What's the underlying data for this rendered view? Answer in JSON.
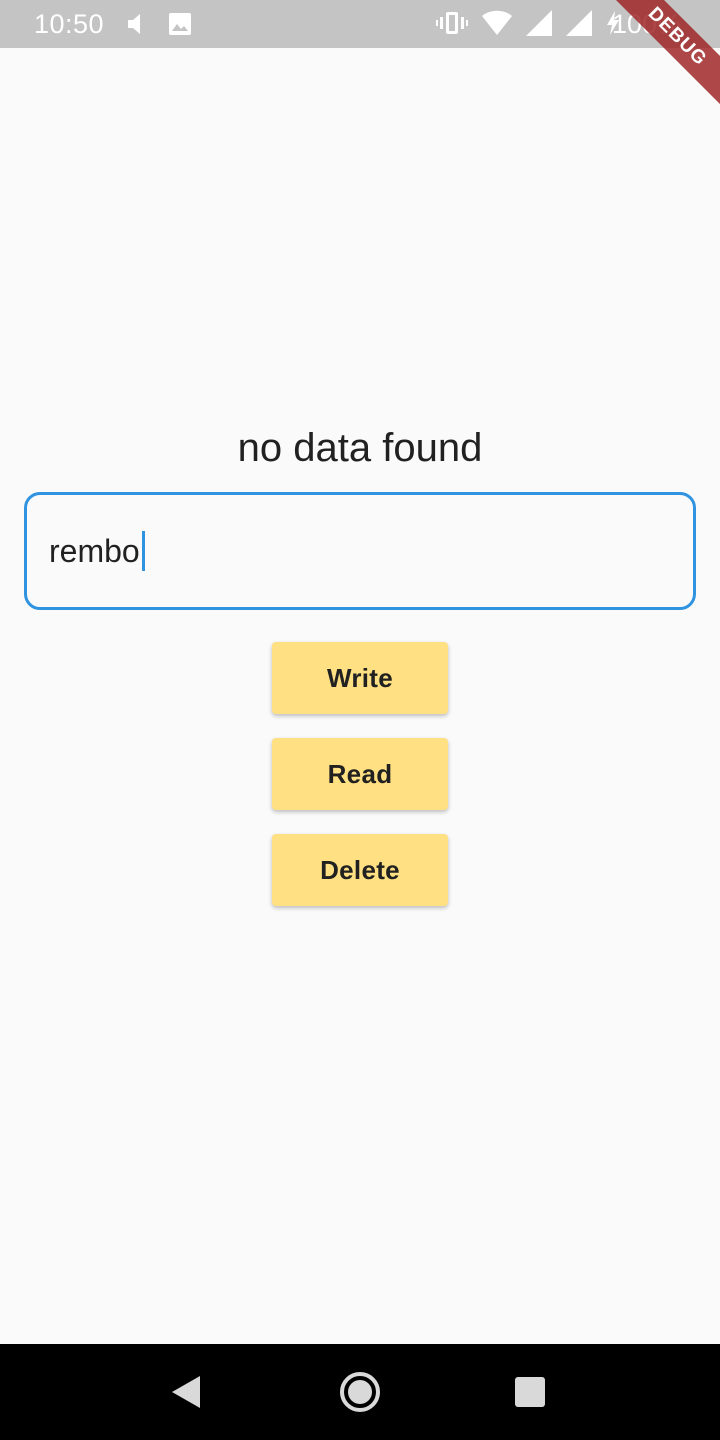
{
  "status_bar": {
    "time": "10:50",
    "battery": "100%",
    "icons": [
      "volume-icon",
      "image-icon",
      "vibrate-icon",
      "wifi-icon",
      "signal-icon",
      "signal-icon-2",
      "charging-icon"
    ]
  },
  "debug_banner": "DEBUG",
  "main": {
    "result_text": "no data found",
    "input": {
      "value": "rembo"
    },
    "buttons": {
      "write": "Write",
      "read": "Read",
      "delete": "Delete"
    }
  },
  "nav_bar": {
    "icons": [
      "back-icon",
      "home-icon",
      "recents-icon"
    ]
  },
  "colors": {
    "background": "#fafafa",
    "accent": "#2f93e0",
    "button": "#ffe082",
    "status_bar": "#c4c4c4",
    "nav_bar": "#000000"
  }
}
